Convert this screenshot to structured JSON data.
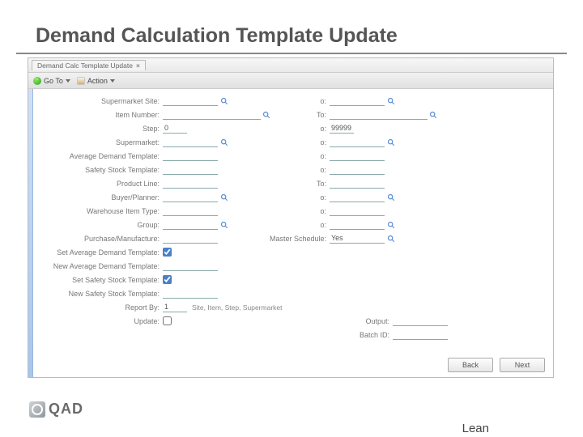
{
  "slide": {
    "title": "Demand Calculation Template Update"
  },
  "window": {
    "tab_title": "Demand Calc Template Update",
    "toolbar": {
      "goto": "Go To",
      "action": "Action"
    }
  },
  "form": {
    "rows": [
      {
        "l_lbl": "Supermarket Site:",
        "l_val": "",
        "l_lookup": true,
        "r_lbl": "o:",
        "r_val": "",
        "r_lookup": true
      },
      {
        "l_lbl": "Item Number:",
        "l_val": "",
        "l_lookup": true,
        "l_wide": true,
        "r_lbl": "To:",
        "r_val": "",
        "r_lookup": true,
        "r_wide": true
      },
      {
        "l_lbl": "Step:",
        "l_val": "0",
        "l_lookup": false,
        "r_lbl": "o:",
        "r_val": "99999",
        "r_lookup": false
      },
      {
        "l_lbl": "Supermarket:",
        "l_val": "",
        "l_lookup": true,
        "r_lbl": "o:",
        "r_val": "",
        "r_lookup": true
      },
      {
        "l_lbl": "Average Demand Template:",
        "l_val": "",
        "l_lookup": false,
        "r_lbl": "o:",
        "r_val": "",
        "r_lookup": false
      },
      {
        "l_lbl": "Safety Stock Template:",
        "l_val": "",
        "l_lookup": false,
        "r_lbl": "o:",
        "r_val": "",
        "r_lookup": false
      },
      {
        "l_lbl": "Product Line:",
        "l_val": "",
        "l_lookup": false,
        "r_lbl": "To:",
        "r_val": "",
        "r_lookup": false
      },
      {
        "l_lbl": "Buyer/Planner:",
        "l_val": "",
        "l_lookup": true,
        "r_lbl": "o:",
        "r_val": "",
        "r_lookup": true
      },
      {
        "l_lbl": "Warehouse Item Type:",
        "l_val": "",
        "l_lookup": false,
        "r_lbl": "o:",
        "r_val": "",
        "r_lookup": false
      },
      {
        "l_lbl": "Group:",
        "l_val": "",
        "l_lookup": true,
        "r_lbl": "o:",
        "r_val": "",
        "r_lookup": true
      }
    ],
    "pm_label": "Purchase/Manufacture:",
    "pm_val": "",
    "ms_label": "Master Schedule:",
    "ms_val": "Yes",
    "set_avg_label": "Set Average Demand Template:",
    "new_avg_label": "New Average Demand Template:",
    "set_ss_label": "Set Safety Stock Template:",
    "new_ss_label": "New Safety Stock Template:",
    "report_by_label": "Report By:",
    "report_by_val": "1",
    "report_by_note": "Site, Item, Step, Supermarket",
    "update_label": "Update:",
    "output_label": "Output:",
    "batch_label": "Batch ID:"
  },
  "buttons": {
    "back": "Back",
    "next": "Next"
  },
  "footer": {
    "brand": "QAD",
    "cut": "Lean"
  }
}
